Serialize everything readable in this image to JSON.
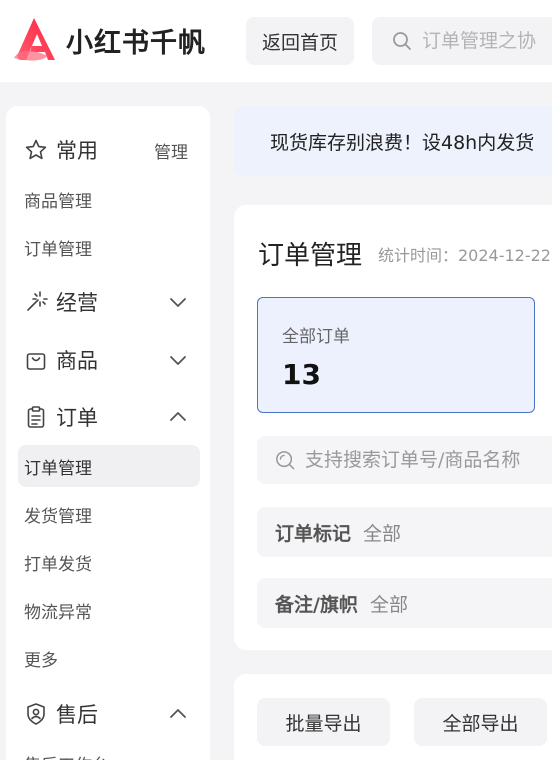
{
  "header": {
    "logo_text": "小红书千帆",
    "back_button": "返回首页",
    "search_placeholder": "订单管理之协"
  },
  "sidebar": {
    "common": {
      "label": "常用",
      "manage_link": "管理"
    },
    "common_items": [
      "商品管理",
      "订单管理"
    ],
    "operations": {
      "label": "经营"
    },
    "products": {
      "label": "商品"
    },
    "orders": {
      "label": "订单"
    },
    "order_items": [
      "订单管理",
      "发货管理",
      "打单发货",
      "物流异常",
      "更多"
    ],
    "after_sales": {
      "label": "售后"
    },
    "after_sales_items": [
      "售后工作台"
    ]
  },
  "notice": {
    "text": "现货库存别浪费！设48h内发货"
  },
  "order_card": {
    "title": "订单管理",
    "subtitle": "统计时间：2024-12-22",
    "stat_label": "全部订单",
    "stat_value": "13",
    "search_placeholder": "支持搜索订单号/商品名称",
    "filters": [
      {
        "label": "订单标记",
        "value": "全部"
      },
      {
        "label": "备注/旗帜",
        "value": "全部"
      }
    ]
  },
  "actions": {
    "batch_export": "批量导出",
    "export_all": "全部导出"
  },
  "colors": {
    "brand": "#ff2442",
    "accent_border": "#4d73c7",
    "stat_bg": "#ecf1fd"
  }
}
